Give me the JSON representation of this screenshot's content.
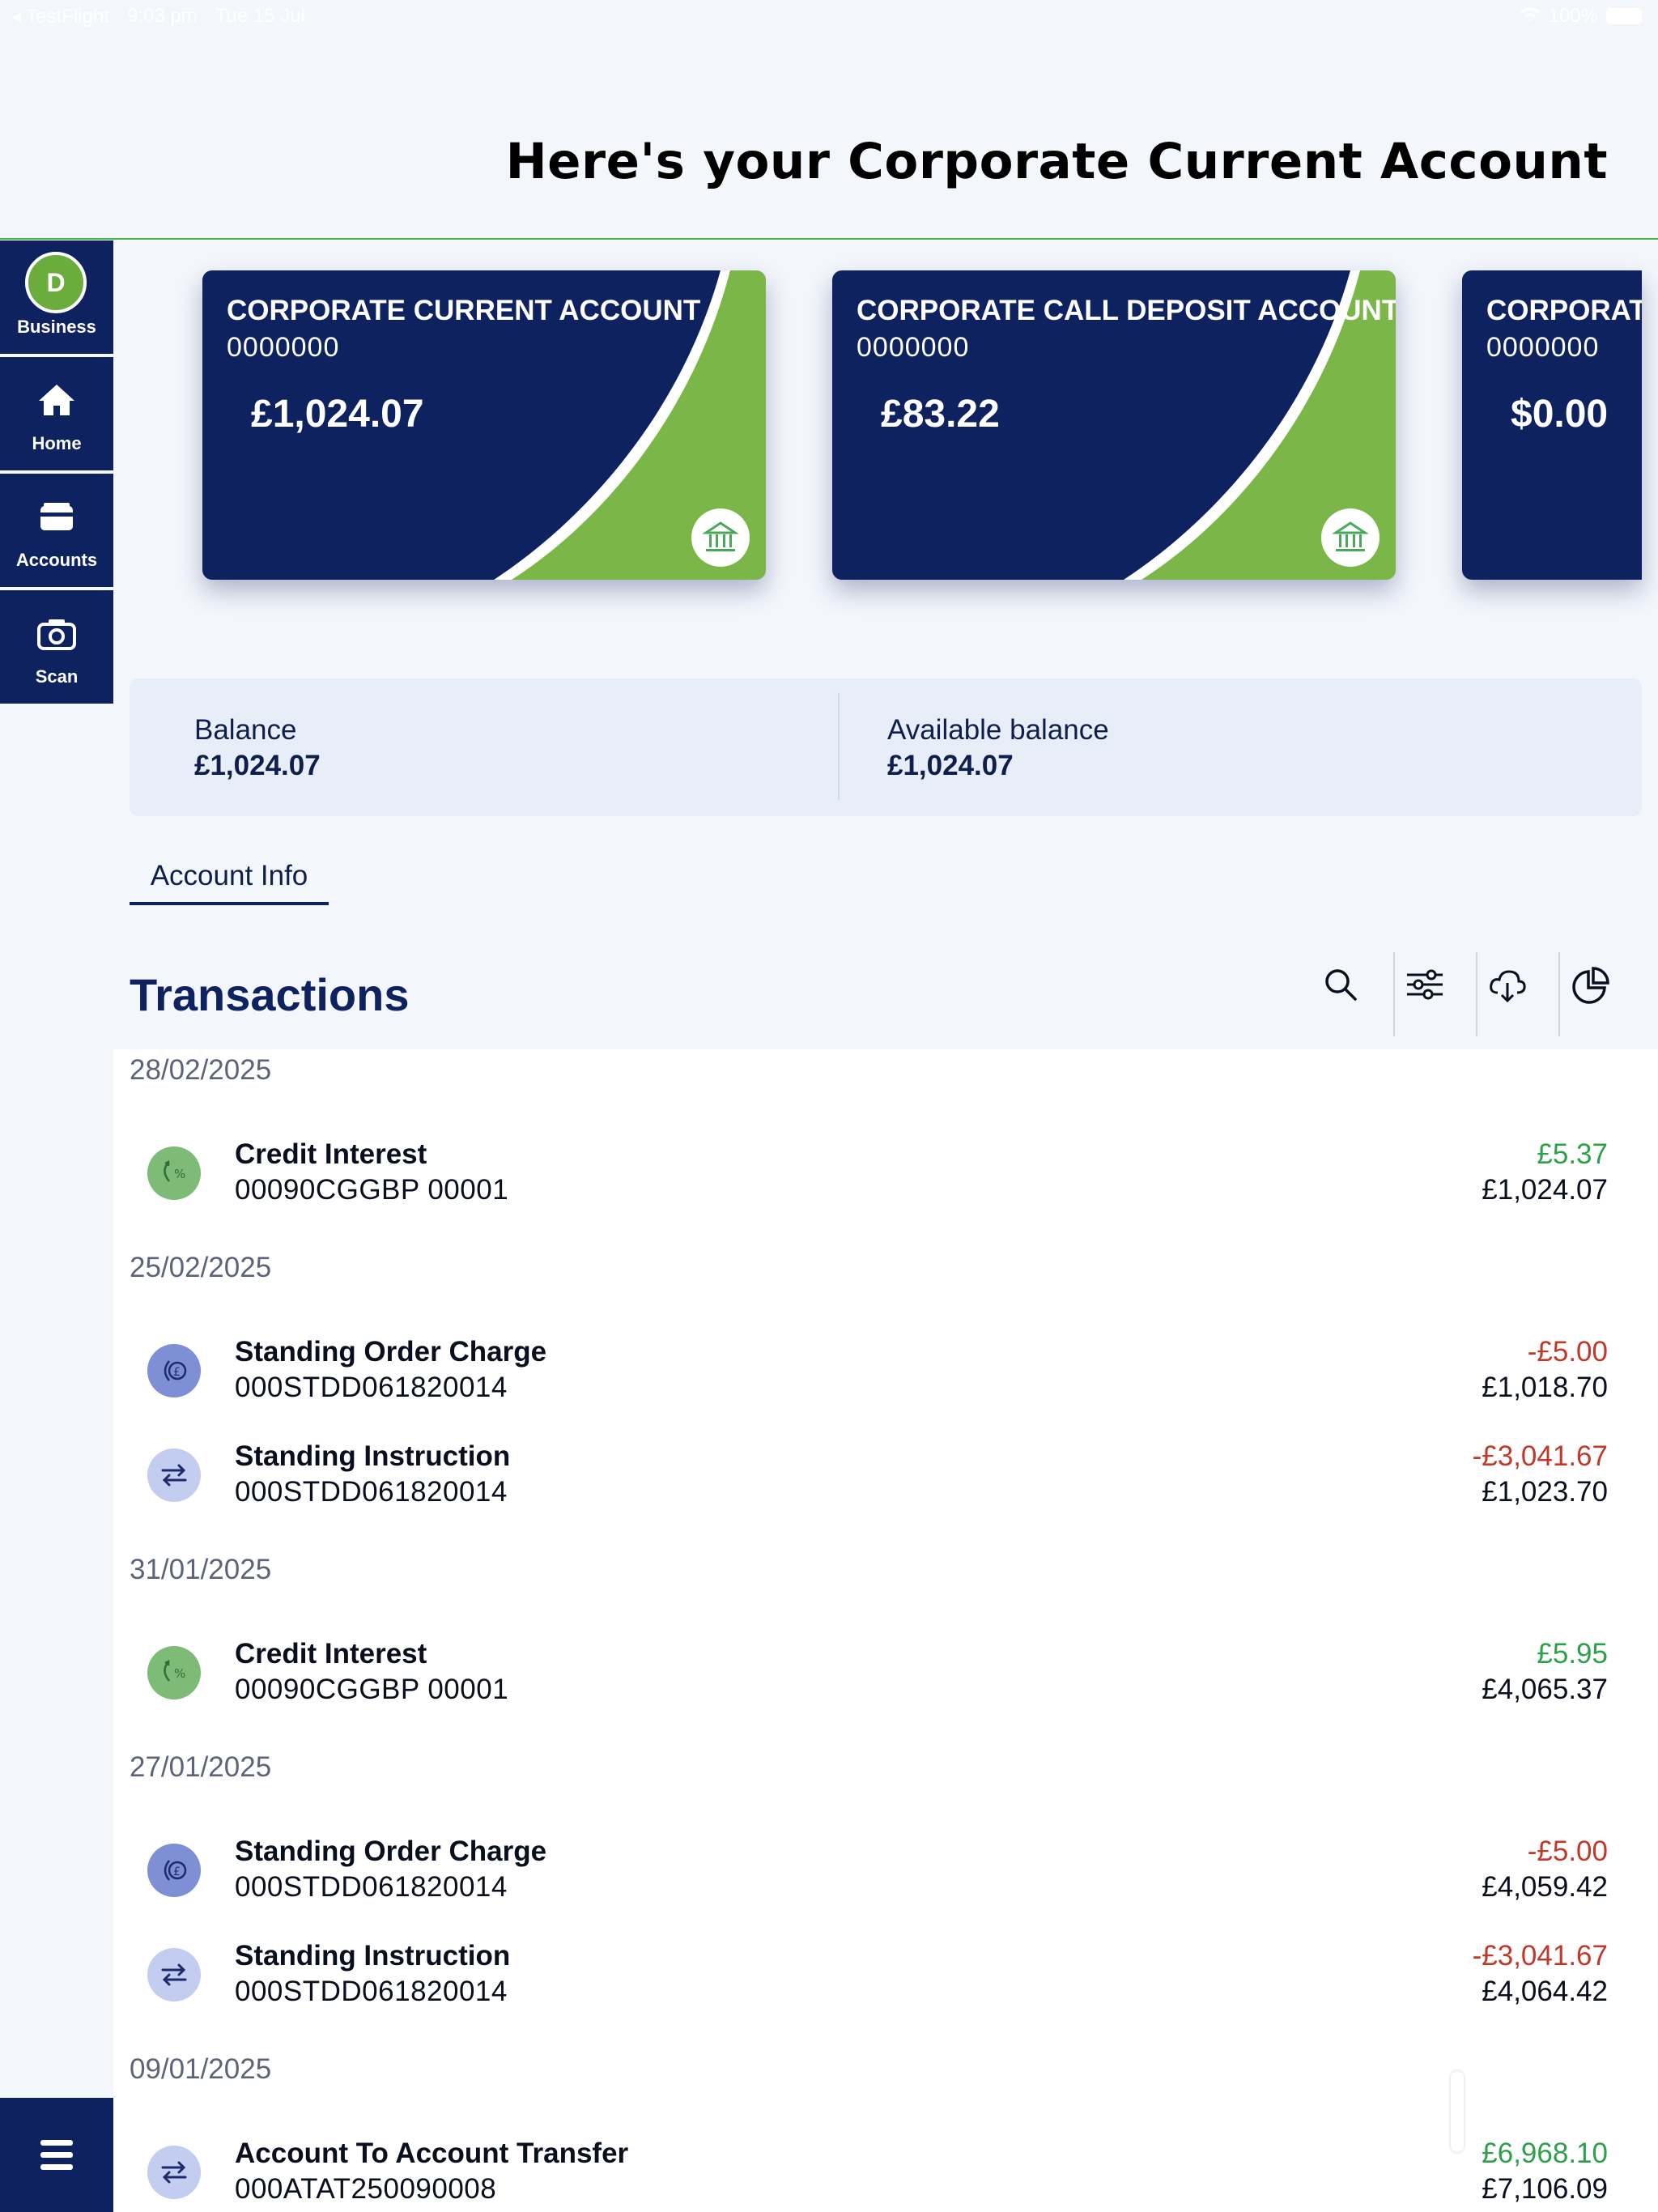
{
  "status_bar": {
    "app": "◂ TestFlight",
    "time": "9:03 pm",
    "date": "Tue 15 Jul",
    "battery": "100%"
  },
  "header": {
    "title": "Here's your Corporate Current Account"
  },
  "sidebar": {
    "avatar_letter": "D",
    "items": [
      {
        "label": "Business",
        "icon": "business-avatar"
      },
      {
        "label": "Home",
        "icon": "home-icon"
      },
      {
        "label": "Accounts",
        "icon": "wallet-icon"
      },
      {
        "label": "Scan",
        "icon": "camera-icon"
      }
    ],
    "menu_icon": "menu-icon"
  },
  "cards": [
    {
      "name": "CORPORATE CURRENT ACCOUNT",
      "number": "0000000",
      "balance": "£1,024.07"
    },
    {
      "name": "CORPORATE CALL DEPOSIT ACCOUNT",
      "number": "0000000",
      "balance": "£83.22"
    },
    {
      "name": "CORPORATE",
      "number": "0000000",
      "balance": "$0.00"
    }
  ],
  "balance": {
    "balance_label": "Balance",
    "balance_value": "£1,024.07",
    "available_label": "Available balance",
    "available_value": "£1,024.07"
  },
  "tabs": {
    "account_info": "Account Info"
  },
  "transactions": {
    "title": "Transactions",
    "toolbar_icons": [
      "search-icon",
      "filter-icon",
      "download-icon",
      "chart-icon"
    ],
    "groups": [
      {
        "date": "28/02/2025",
        "items": [
          {
            "title": "Credit Interest",
            "ref": "00090CGGBP 00001",
            "amount": "£5.37",
            "running": "£1,024.07",
            "type": "credit",
            "icon": "interest-icon"
          }
        ]
      },
      {
        "date": "25/02/2025",
        "items": [
          {
            "title": "Standing Order Charge",
            "ref": "000STDD061820014",
            "amount": "-£5.00",
            "running": "£1,018.70",
            "type": "debit",
            "icon": "charge-icon"
          },
          {
            "title": "Standing Instruction",
            "ref": "000STDD061820014",
            "amount": "-£3,041.67",
            "running": "£1,023.70",
            "type": "debit",
            "icon": "transfer-icon"
          }
        ]
      },
      {
        "date": "31/01/2025",
        "items": [
          {
            "title": "Credit Interest",
            "ref": "00090CGGBP 00001",
            "amount": "£5.95",
            "running": "£4,065.37",
            "type": "credit",
            "icon": "interest-icon"
          }
        ]
      },
      {
        "date": "27/01/2025",
        "items": [
          {
            "title": "Standing Order Charge",
            "ref": "000STDD061820014",
            "amount": "-£5.00",
            "running": "£4,059.42",
            "type": "debit",
            "icon": "charge-icon"
          },
          {
            "title": "Standing Instruction",
            "ref": "000STDD061820014",
            "amount": "-£3,041.67",
            "running": "£4,064.42",
            "type": "debit",
            "icon": "transfer-icon"
          }
        ]
      },
      {
        "date": "09/01/2025",
        "items": [
          {
            "title": "Account To Account Transfer",
            "ref": "000ATAT250090008",
            "amount": "£6,968.10",
            "running": "£7,106.09",
            "type": "credit",
            "icon": "transfer-icon"
          }
        ]
      }
    ]
  },
  "colors": {
    "navy": "#0f2260",
    "green": "#6aad3d",
    "credit": "#2ea04a",
    "debit": "#c0392b"
  }
}
